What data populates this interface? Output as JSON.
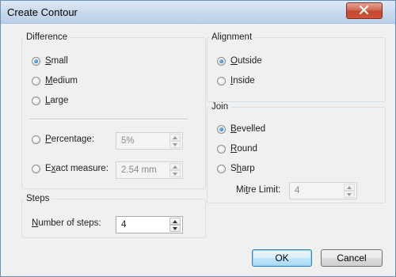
{
  "window": {
    "title": "Create Contour"
  },
  "difference": {
    "legend": "Difference",
    "small": {
      "pre": "",
      "key": "S",
      "post": "mall",
      "checked": true
    },
    "medium": {
      "pre": "",
      "key": "M",
      "post": "edium",
      "checked": false
    },
    "large": {
      "pre": "",
      "key": "L",
      "post": "arge",
      "checked": false
    },
    "percentage": {
      "pre": "",
      "key": "P",
      "post": "ercentage:",
      "checked": false,
      "value": "5%"
    },
    "exact": {
      "pre": "E",
      "key": "x",
      "post": "act measure:",
      "checked": false,
      "value": "2.54 mm"
    }
  },
  "steps": {
    "legend": "Steps",
    "label": {
      "pre": "",
      "key": "N",
      "post": "umber of steps:"
    },
    "value": "4"
  },
  "alignment": {
    "legend": "Alignment",
    "outside": {
      "pre": "",
      "key": "O",
      "post": "utside",
      "checked": true
    },
    "inside": {
      "pre": "",
      "key": "I",
      "post": "nside",
      "checked": false
    }
  },
  "join": {
    "legend": "Join",
    "bevelled": {
      "pre": "",
      "key": "B",
      "post": "evelled",
      "checked": true
    },
    "round": {
      "pre": "",
      "key": "R",
      "post": "ound",
      "checked": false
    },
    "sharp": {
      "pre": "S",
      "key": "h",
      "post": "arp",
      "checked": false
    },
    "mitre": {
      "pre": "Mi",
      "key": "t",
      "post": "re Limit:",
      "value": "4"
    }
  },
  "buttons": {
    "ok": "OK",
    "cancel": "Cancel"
  }
}
